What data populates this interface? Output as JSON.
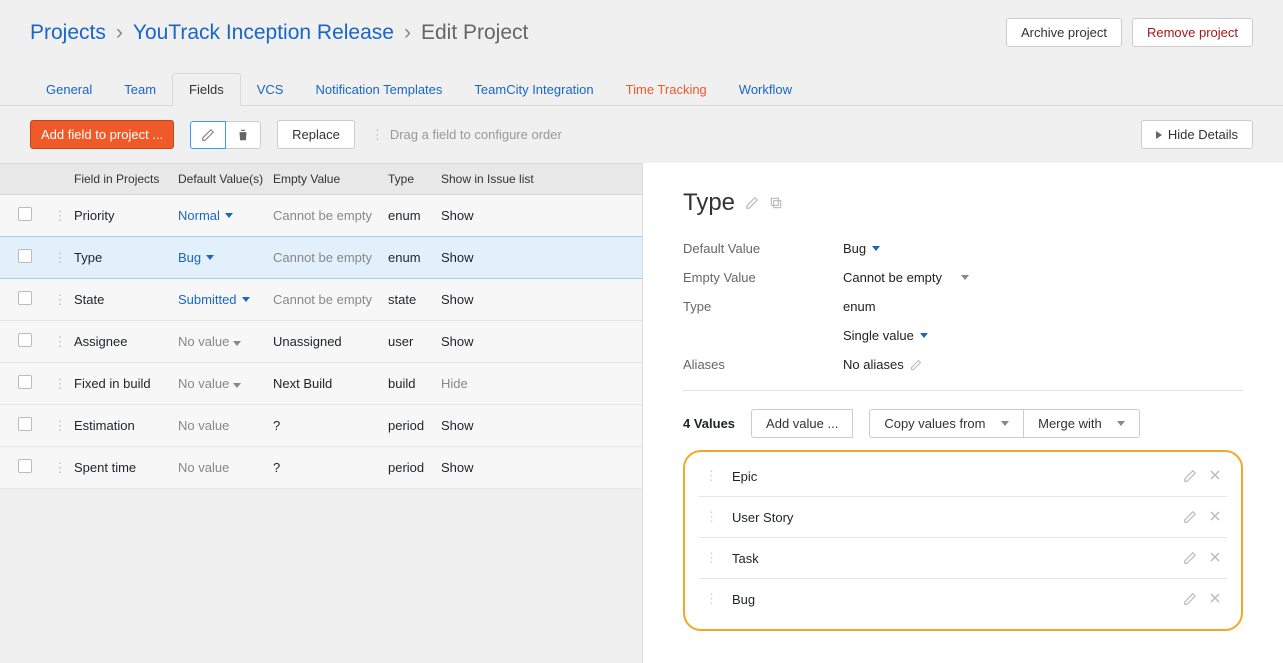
{
  "breadcrumb": {
    "root": "Projects",
    "project": "YouTrack Inception Release",
    "page": "Edit Project"
  },
  "header_buttons": {
    "archive": "Archive project",
    "remove": "Remove project"
  },
  "tabs": [
    "General",
    "Team",
    "Fields",
    "VCS",
    "Notification Templates",
    "TeamCity Integration",
    "Time Tracking",
    "Workflow"
  ],
  "active_tab": "Fields",
  "orange_tab": "Time Tracking",
  "toolbar": {
    "add": "Add field to project ...",
    "replace": "Replace",
    "drag_hint": "Drag a field to configure order",
    "hide_details": "Hide Details"
  },
  "columns": {
    "name": "Field in Projects",
    "default": "Default Value(s)",
    "empty": "Empty Value",
    "type": "Type",
    "show": "Show in Issue list"
  },
  "rows": [
    {
      "name": "Priority",
      "default": "Normal",
      "default_link": true,
      "empty": "Cannot be empty",
      "empty_muted": true,
      "type": "enum",
      "show": "Show"
    },
    {
      "name": "Type",
      "default": "Bug",
      "default_link": true,
      "empty": "Cannot be empty",
      "empty_muted": true,
      "type": "enum",
      "show": "Show",
      "selected": true
    },
    {
      "name": "State",
      "default": "Submitted",
      "default_link": true,
      "empty": "Cannot be empty",
      "empty_muted": true,
      "type": "state",
      "show": "Show"
    },
    {
      "name": "Assignee",
      "default": "No value",
      "default_link": false,
      "empty": "Unassigned",
      "empty_muted": false,
      "type": "user",
      "show": "Show"
    },
    {
      "name": "Fixed in build",
      "default": "No value",
      "default_link": false,
      "empty": "Next Build",
      "empty_muted": false,
      "type": "build",
      "show": "Hide",
      "show_muted": true
    },
    {
      "name": "Estimation",
      "default": "No value",
      "default_link": false,
      "no_caret": true,
      "empty": "?",
      "empty_muted": false,
      "type": "period",
      "show": "Show"
    },
    {
      "name": "Spent time",
      "default": "No value",
      "default_link": false,
      "no_caret": true,
      "empty": "?",
      "empty_muted": false,
      "type": "period",
      "show": "Show"
    }
  ],
  "detail": {
    "title": "Type",
    "default_k": "Default Value",
    "default_v": "Bug",
    "empty_k": "Empty Value",
    "empty_v": "Cannot be empty",
    "type_k": "Type",
    "type_v": "enum",
    "single": "Single value",
    "aliases_k": "Aliases",
    "aliases_v": "No aliases",
    "values_label": "4 Values",
    "add_value": "Add value ...",
    "copy_from": "Copy values from",
    "merge": "Merge with",
    "values": [
      "Epic",
      "User Story",
      "Task",
      "Bug"
    ]
  }
}
